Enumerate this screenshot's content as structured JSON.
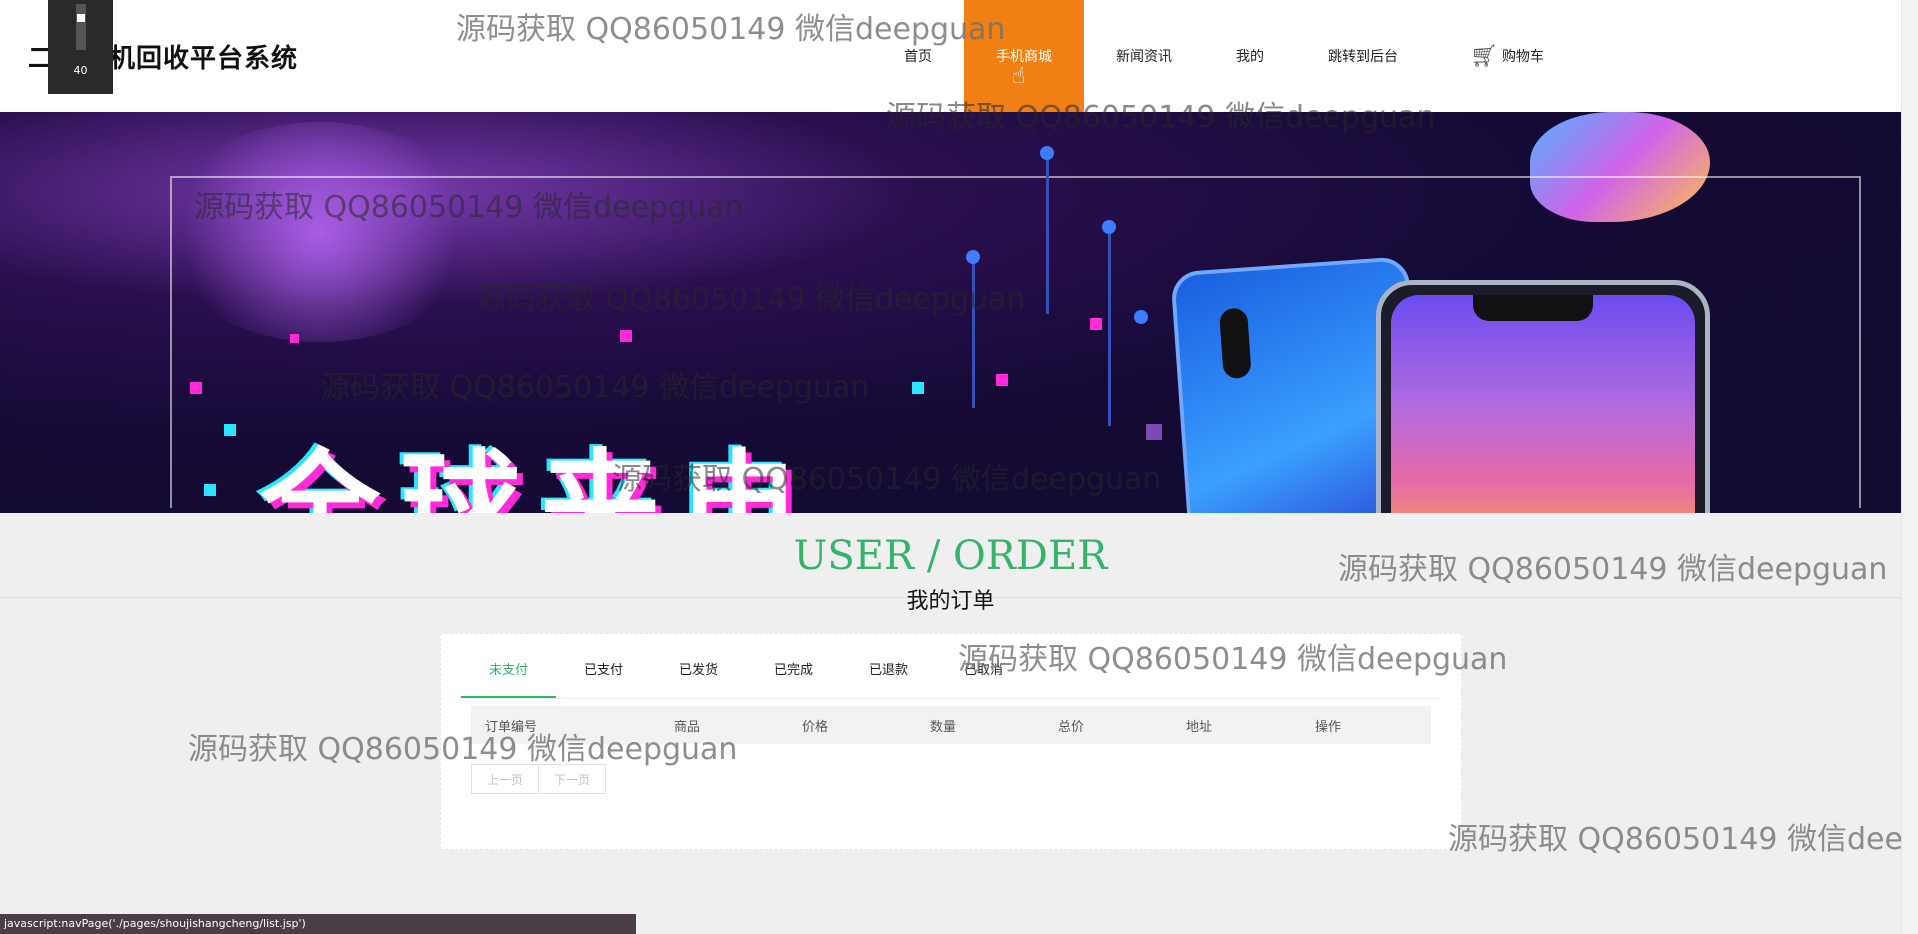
{
  "site": {
    "title": "二手手机回收平台系统"
  },
  "overlay_badge": {
    "number": "40"
  },
  "nav": {
    "items": [
      {
        "label": "首页"
      },
      {
        "label": "手机商城"
      },
      {
        "label": "新闻资讯"
      },
      {
        "label": "我的"
      },
      {
        "label": "跳转到后台"
      }
    ],
    "cart_label": "购物车",
    "cart_icon": "cart-icon"
  },
  "banner": {
    "slogan": "全球来电"
  },
  "section": {
    "title_en": "USER / ORDER",
    "title_zh": "我的订单"
  },
  "orders": {
    "tabs": [
      "未支付",
      "已支付",
      "已发货",
      "已完成",
      "已退款",
      "已取消"
    ],
    "columns": [
      "订单编号",
      "商品",
      "价格",
      "数量",
      "总价",
      "地址",
      "操作"
    ],
    "prev_label": "上一页",
    "next_label": "下一页"
  },
  "watermark": "源码获取 QQ86050149 微信deepguan",
  "status_url": "javascript:navPage('./pages/shoujishangcheng/list.jsp')",
  "colors": {
    "accent": "#35b36b",
    "nav_active": "#f08014",
    "status_bar": "#4b3d45"
  }
}
